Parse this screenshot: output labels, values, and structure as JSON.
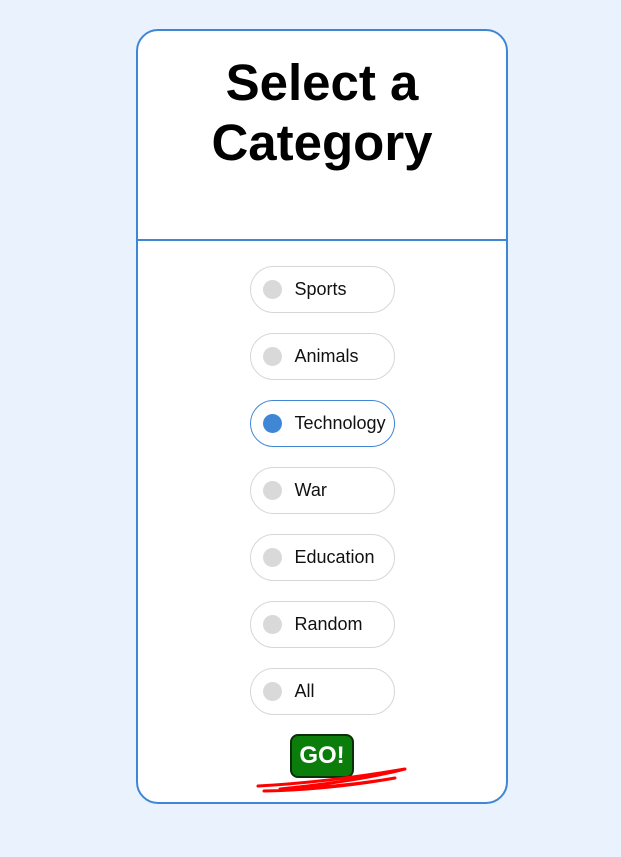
{
  "page": {
    "title": "Select a Category"
  },
  "categories": [
    {
      "label": "Sports",
      "selected": false
    },
    {
      "label": "Animals",
      "selected": false
    },
    {
      "label": "Technology",
      "selected": true
    },
    {
      "label": "War",
      "selected": false
    },
    {
      "label": "Education",
      "selected": false
    },
    {
      "label": "Random",
      "selected": false
    },
    {
      "label": "All",
      "selected": false
    }
  ],
  "actions": {
    "go_label": "GO!"
  },
  "colors": {
    "background": "#eaf2fd",
    "accent": "#3f87d4",
    "go_button": "#0a7d0a",
    "annotation": "#ff0000"
  }
}
